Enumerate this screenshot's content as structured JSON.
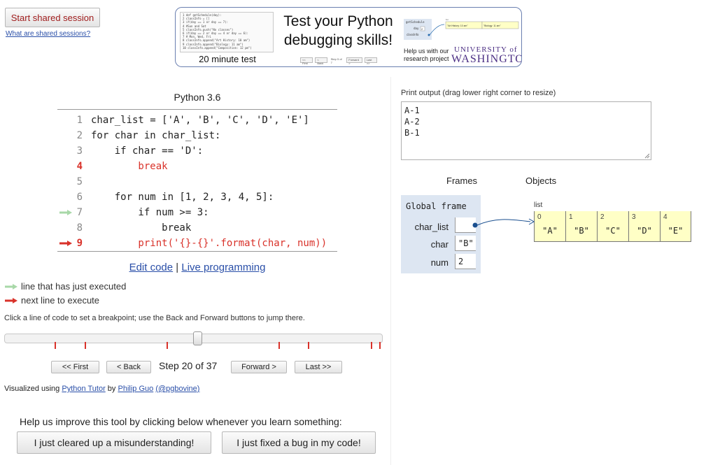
{
  "header": {
    "start_shared_label": "Start shared session",
    "what_shared_label": "What are shared sessions?"
  },
  "banner": {
    "title": "Test your Python debugging skills!",
    "minute_test": "20 minute test",
    "help_line1": "Help us with our",
    "help_line2": "research project",
    "university_line1": "UNIVERSITY of",
    "university_line2": "WASHINGTON",
    "university_color": "#4b2e83"
  },
  "code_panel": {
    "language": "Python 3.6",
    "lines": [
      {
        "num": "1",
        "text": "char_list = ['A', 'B', 'C', 'D', 'E']"
      },
      {
        "num": "2",
        "text": "for char in char_list:"
      },
      {
        "num": "3",
        "text": "    if char == 'D':"
      },
      {
        "num": "4",
        "text": "        break"
      },
      {
        "num": "5",
        "text": ""
      },
      {
        "num": "6",
        "text": "    for num in [1, 2, 3, 4, 5]:"
      },
      {
        "num": "7",
        "text": "        if num >= 3:"
      },
      {
        "num": "8",
        "text": "            break"
      },
      {
        "num": "9",
        "text": "        print('{}-{}'.format(char, num))"
      }
    ],
    "breakpoint_line": "4",
    "just_executed_line": "7",
    "next_line": "9",
    "edit_code_label": "Edit code",
    "separator": "|",
    "live_programming_label": "Live programming",
    "just_executed_color": "#a8d8a8",
    "next_line_color": "#d9322a"
  },
  "legend": {
    "just_executed": "line that has just executed",
    "next_to_execute": "next line to execute"
  },
  "instructions": "Click a line of code to set a breakpoint; use the Back and Forward buttons to jump there.",
  "navigation": {
    "first_label": "<< First",
    "back_label": "< Back",
    "step_text": "Step 20 of 37",
    "forward_label": "Forward >",
    "last_label": "Last >>",
    "current_step": 20,
    "total_steps": 37
  },
  "credit": {
    "prefix": "Visualized using",
    "tool": "Python Tutor",
    "by": "by",
    "author": "Philip Guo",
    "handle": "(@pgbovine)"
  },
  "feedback": {
    "prompt": "Help us improve this tool by clicking below whenever you learn something:",
    "misunderstanding_label": "I just cleared up a misunderstanding!",
    "bug_label": "I just fixed a bug in my code!"
  },
  "output": {
    "label": "Print output (drag lower right corner to resize)",
    "lines": [
      "A-1",
      "A-2",
      "B-1"
    ]
  },
  "visualization": {
    "frames_label": "Frames",
    "objects_label": "Objects",
    "frame_title": "Global frame",
    "variables": [
      {
        "name": "char_list",
        "value": ""
      },
      {
        "name": "char",
        "value": "\"B\""
      },
      {
        "name": "num",
        "value": "2"
      }
    ],
    "list_label": "list",
    "list_items": [
      {
        "index": "0",
        "value": "\"A\""
      },
      {
        "index": "1",
        "value": "\"B\""
      },
      {
        "index": "2",
        "value": "\"C\""
      },
      {
        "index": "3",
        "value": "\"D\""
      },
      {
        "index": "4",
        "value": "\"E\""
      }
    ],
    "frame_color": "#dde6f2",
    "list_color": "#ffffc6"
  }
}
